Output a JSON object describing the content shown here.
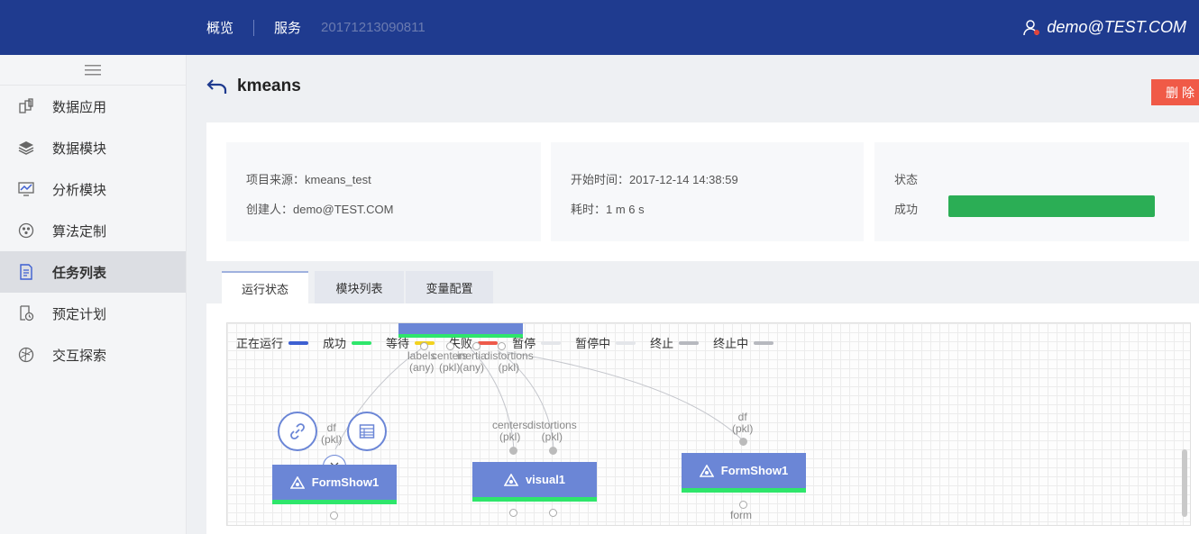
{
  "header": {
    "nav": [
      "概览",
      "服务"
    ],
    "job_id": "20171213090811",
    "user": "demo@TEST.COM"
  },
  "sidebar": {
    "items": [
      {
        "label": "数据应用",
        "icon": "data-app-icon"
      },
      {
        "label": "数据模块",
        "icon": "layers-icon"
      },
      {
        "label": "分析模块",
        "icon": "analysis-icon"
      },
      {
        "label": "算法定制",
        "icon": "algorithm-icon"
      },
      {
        "label": "任务列表",
        "icon": "task-list-icon",
        "active": true
      },
      {
        "label": "预定计划",
        "icon": "schedule-icon"
      },
      {
        "label": "交互探索",
        "icon": "explore-icon"
      }
    ]
  },
  "page": {
    "title": "kmeans",
    "delete_label": "删除"
  },
  "info": {
    "source": "项目来源：kmeans_test",
    "creator": "创建人：demo@TEST.COM",
    "start_time": "开始时间：2017-12-14    14:38:59",
    "duration": "耗时：1 m 6 s",
    "status_label": "状态",
    "status_value": "成功",
    "status_color": "#2bae55"
  },
  "tabs": [
    "运行状态",
    "模块列表",
    "变量配置"
  ],
  "legend": [
    {
      "label": "正在运行",
      "color": "#3d5fd1"
    },
    {
      "label": "成功",
      "color": "#2ee66b"
    },
    {
      "label": "等待",
      "color": "#f2d21f"
    },
    {
      "label": "失败",
      "color": "#ee5a4a"
    },
    {
      "label": "暂停",
      "color": "#e4e6ea"
    },
    {
      "label": "暂停中",
      "color": "#e4e6ea"
    },
    {
      "label": "终止",
      "color": "#b7b9bf"
    },
    {
      "label": "终止中",
      "color": "#b7b9bf"
    }
  ],
  "graph": {
    "top_ports": [
      {
        "name": "labels",
        "type": "(any)"
      },
      {
        "name": "centers",
        "type": "(pkl)"
      },
      {
        "name": "inertia",
        "type": "(any)"
      },
      {
        "name": "distortions",
        "type": "(pkl)"
      }
    ],
    "nodes": [
      {
        "label": "FormShow1",
        "inputs": [
          {
            "name": "df",
            "type": "(pkl)"
          }
        ]
      },
      {
        "label": "visual1",
        "inputs": [
          {
            "name": "centers",
            "type": "(pkl)"
          },
          {
            "name": "distortions",
            "type": "(pkl)"
          }
        ]
      },
      {
        "label": "FormShow1",
        "inputs": [
          {
            "name": "df",
            "type": "(pkl)"
          }
        ],
        "outputs": [
          "form"
        ]
      }
    ]
  }
}
